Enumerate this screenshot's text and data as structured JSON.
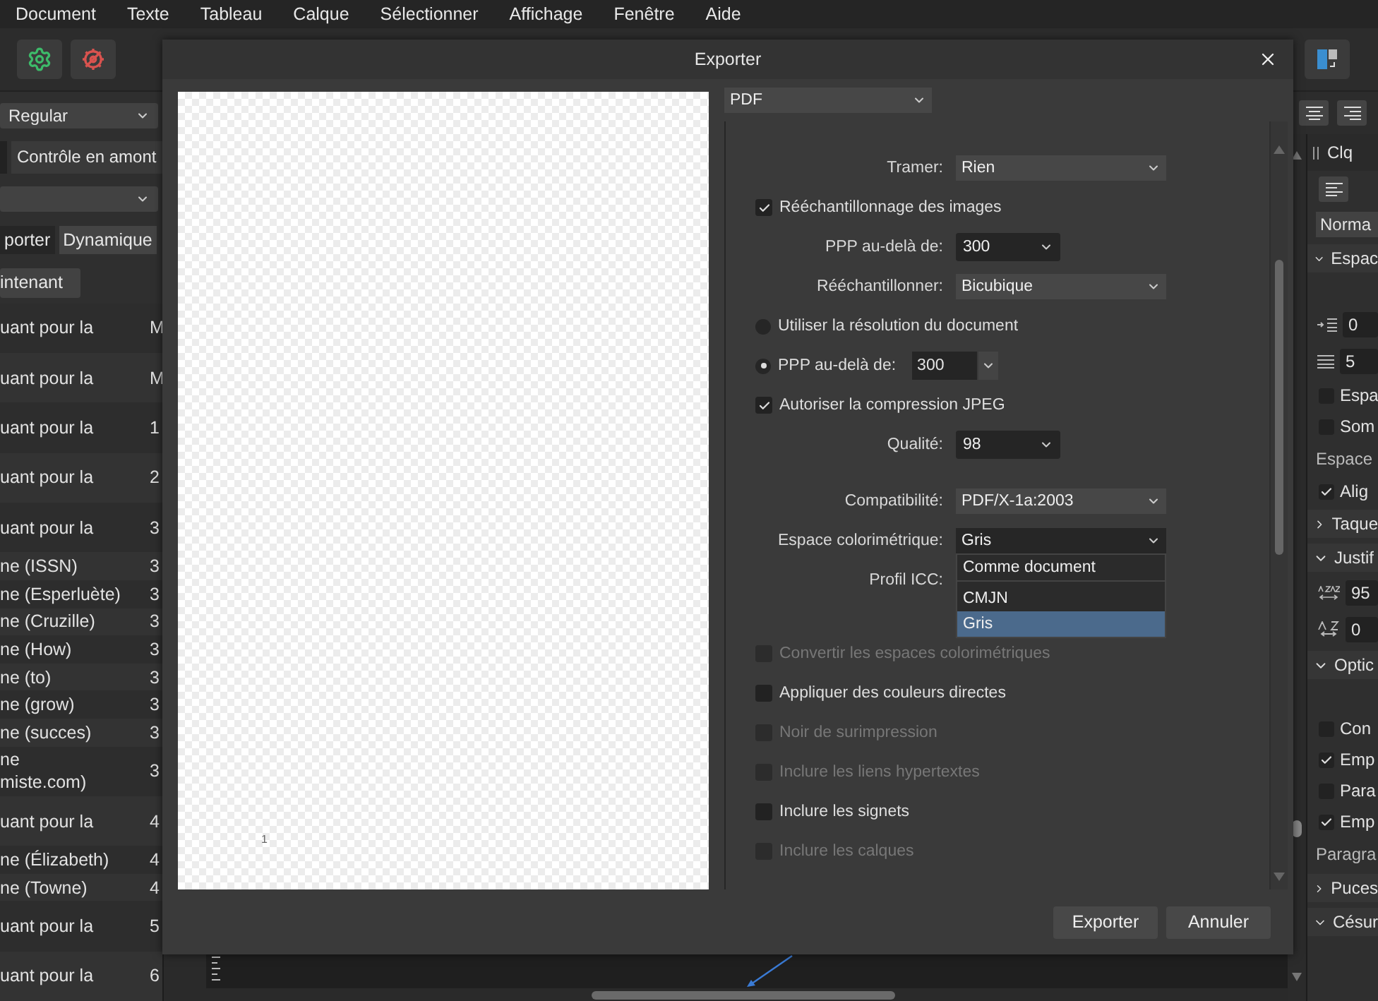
{
  "menu": [
    "Document",
    "Texte",
    "Tableau",
    "Calque",
    "Sélectionner",
    "Affichage",
    "Fenêtre",
    "Aide"
  ],
  "left_panel": {
    "font_style": "Regular",
    "tabs": [
      {
        "label": "Contrôle en amont",
        "selected": true
      }
    ],
    "sub_tabs": [
      {
        "label": "porter",
        "selected": true
      },
      {
        "label": "Dynamique",
        "selected": false
      }
    ],
    "action_button": "intenant",
    "rows": [
      {
        "kind": "tall",
        "text": "uant pour la",
        "column_2": "M"
      },
      {
        "kind": "tall",
        "text": "uant pour la",
        "column_2": "M"
      },
      {
        "kind": "tall",
        "text": "uant pour la",
        "column_2": "1"
      },
      {
        "kind": "tall",
        "text": "uant pour la",
        "column_2": "2"
      },
      {
        "kind": "tall",
        "text": "uant pour la",
        "column_2": "3"
      },
      {
        "kind": "short",
        "text": "ne (ISSN)",
        "column_2": "3"
      },
      {
        "kind": "short",
        "text": "ne (Esperluète)",
        "column_2": "3"
      },
      {
        "kind": "short",
        "text": "ne (Cruzille)",
        "column_2": "3"
      },
      {
        "kind": "short",
        "text": "ne (How)",
        "column_2": "3"
      },
      {
        "kind": "short",
        "text": "ne (to)",
        "column_2": "3"
      },
      {
        "kind": "short",
        "text": "ne (grow)",
        "column_2": "3"
      },
      {
        "kind": "short",
        "text": "ne (succes)",
        "column_2": "3"
      },
      {
        "kind": "tall",
        "text": "ne\nmiste.com)",
        "column_2": "3"
      },
      {
        "kind": "tall",
        "text": "uant pour la",
        "column_2": "4"
      },
      {
        "kind": "short",
        "text": "ne (Élizabeth)",
        "column_2": "4"
      },
      {
        "kind": "short",
        "text": "ne (Towne)",
        "column_2": "4"
      },
      {
        "kind": "tall",
        "text": "uant pour la",
        "column_2": "5"
      },
      {
        "kind": "tall",
        "text": "uant pour la",
        "column_2": "6"
      }
    ]
  },
  "right_panel": {
    "tab": "Clq",
    "items": [
      {
        "kind": "field",
        "value": "Norma"
      },
      {
        "kind": "header",
        "label": "Espac",
        "expanded": true
      },
      {
        "kind": "blank"
      },
      {
        "kind": "indent",
        "value": "0"
      },
      {
        "kind": "spacing",
        "value": "5"
      },
      {
        "kind": "check",
        "label": "Espa",
        "checked": false
      },
      {
        "kind": "check",
        "label": "Som",
        "checked": false
      },
      {
        "kind": "text",
        "label": "Espace"
      },
      {
        "kind": "check",
        "label": "Alig",
        "checked": true
      },
      {
        "kind": "header",
        "label": "Taque",
        "expanded": false
      },
      {
        "kind": "header",
        "label": "Justif",
        "expanded": true
      },
      {
        "kind": "tracking",
        "value": "95"
      },
      {
        "kind": "scaling",
        "value": "0"
      },
      {
        "kind": "header",
        "label": "Optic",
        "expanded": true
      },
      {
        "kind": "blank"
      },
      {
        "kind": "check",
        "label": "Con",
        "checked": false
      },
      {
        "kind": "check",
        "label": "Emp",
        "checked": true
      },
      {
        "kind": "check",
        "label": "Para",
        "checked": false
      },
      {
        "kind": "check",
        "label": "Emp",
        "checked": true
      },
      {
        "kind": "text",
        "label": "Paragra"
      },
      {
        "kind": "header",
        "label": "Puces",
        "expanded": false
      },
      {
        "kind": "header",
        "label": "Césur",
        "expanded": true
      }
    ]
  },
  "dialog": {
    "title": "Exporter",
    "format": "PDF",
    "preview_page_number": "1",
    "settings": [
      {
        "kind": "select",
        "label": "Tramer:",
        "value": "Rien",
        "expanded": false
      },
      {
        "kind": "check",
        "label": "Rééchantillonnage des images",
        "checked": true,
        "disabled": false
      },
      {
        "kind": "number",
        "label": "PPP au-delà de:",
        "value": "300"
      },
      {
        "kind": "select",
        "label": "Rééchantillonner:",
        "value": "Bicubique",
        "expanded": false
      },
      {
        "kind": "radio",
        "label": "Utiliser la résolution du document",
        "selected": false
      },
      {
        "kind": "radio_number",
        "label": "PPP au-delà de:",
        "value": "300",
        "selected": true
      },
      {
        "kind": "check",
        "label": "Autoriser la compression JPEG",
        "checked": true,
        "disabled": false
      },
      {
        "kind": "number",
        "label": "Qualité:",
        "value": "98"
      },
      {
        "kind": "gap"
      },
      {
        "kind": "select",
        "label": "Compatibilité:",
        "value": "PDF/X-1a:2003",
        "expanded": false
      },
      {
        "kind": "select",
        "label": "Espace colorimétrique:",
        "value": "Gris",
        "expanded": true,
        "options": [
          {
            "label": "Comme document",
            "selected": false
          },
          {
            "label": "CMJN",
            "selected": false
          },
          {
            "label": "Gris",
            "selected": true
          }
        ]
      },
      {
        "kind": "select",
        "label": "Profil ICC:"
      },
      {
        "kind": "gap"
      },
      {
        "kind": "gap"
      },
      {
        "kind": "check",
        "label": "Convertir les espaces colorimétriques",
        "checked": false,
        "disabled": true
      },
      {
        "kind": "check",
        "label": "Appliquer des couleurs directes",
        "checked": false,
        "disabled": false
      },
      {
        "kind": "check",
        "label": "Noir de surimpression",
        "checked": false,
        "disabled": true
      },
      {
        "kind": "check",
        "label": "Inclure les liens hypertextes",
        "checked": false,
        "disabled": true
      },
      {
        "kind": "check",
        "label": "Inclure les signets",
        "checked": false,
        "disabled": false
      },
      {
        "kind": "check",
        "label": "Inclure les calques",
        "checked": false,
        "disabled": true
      }
    ],
    "buttons": [
      "Exporter",
      "Annuler"
    ]
  }
}
